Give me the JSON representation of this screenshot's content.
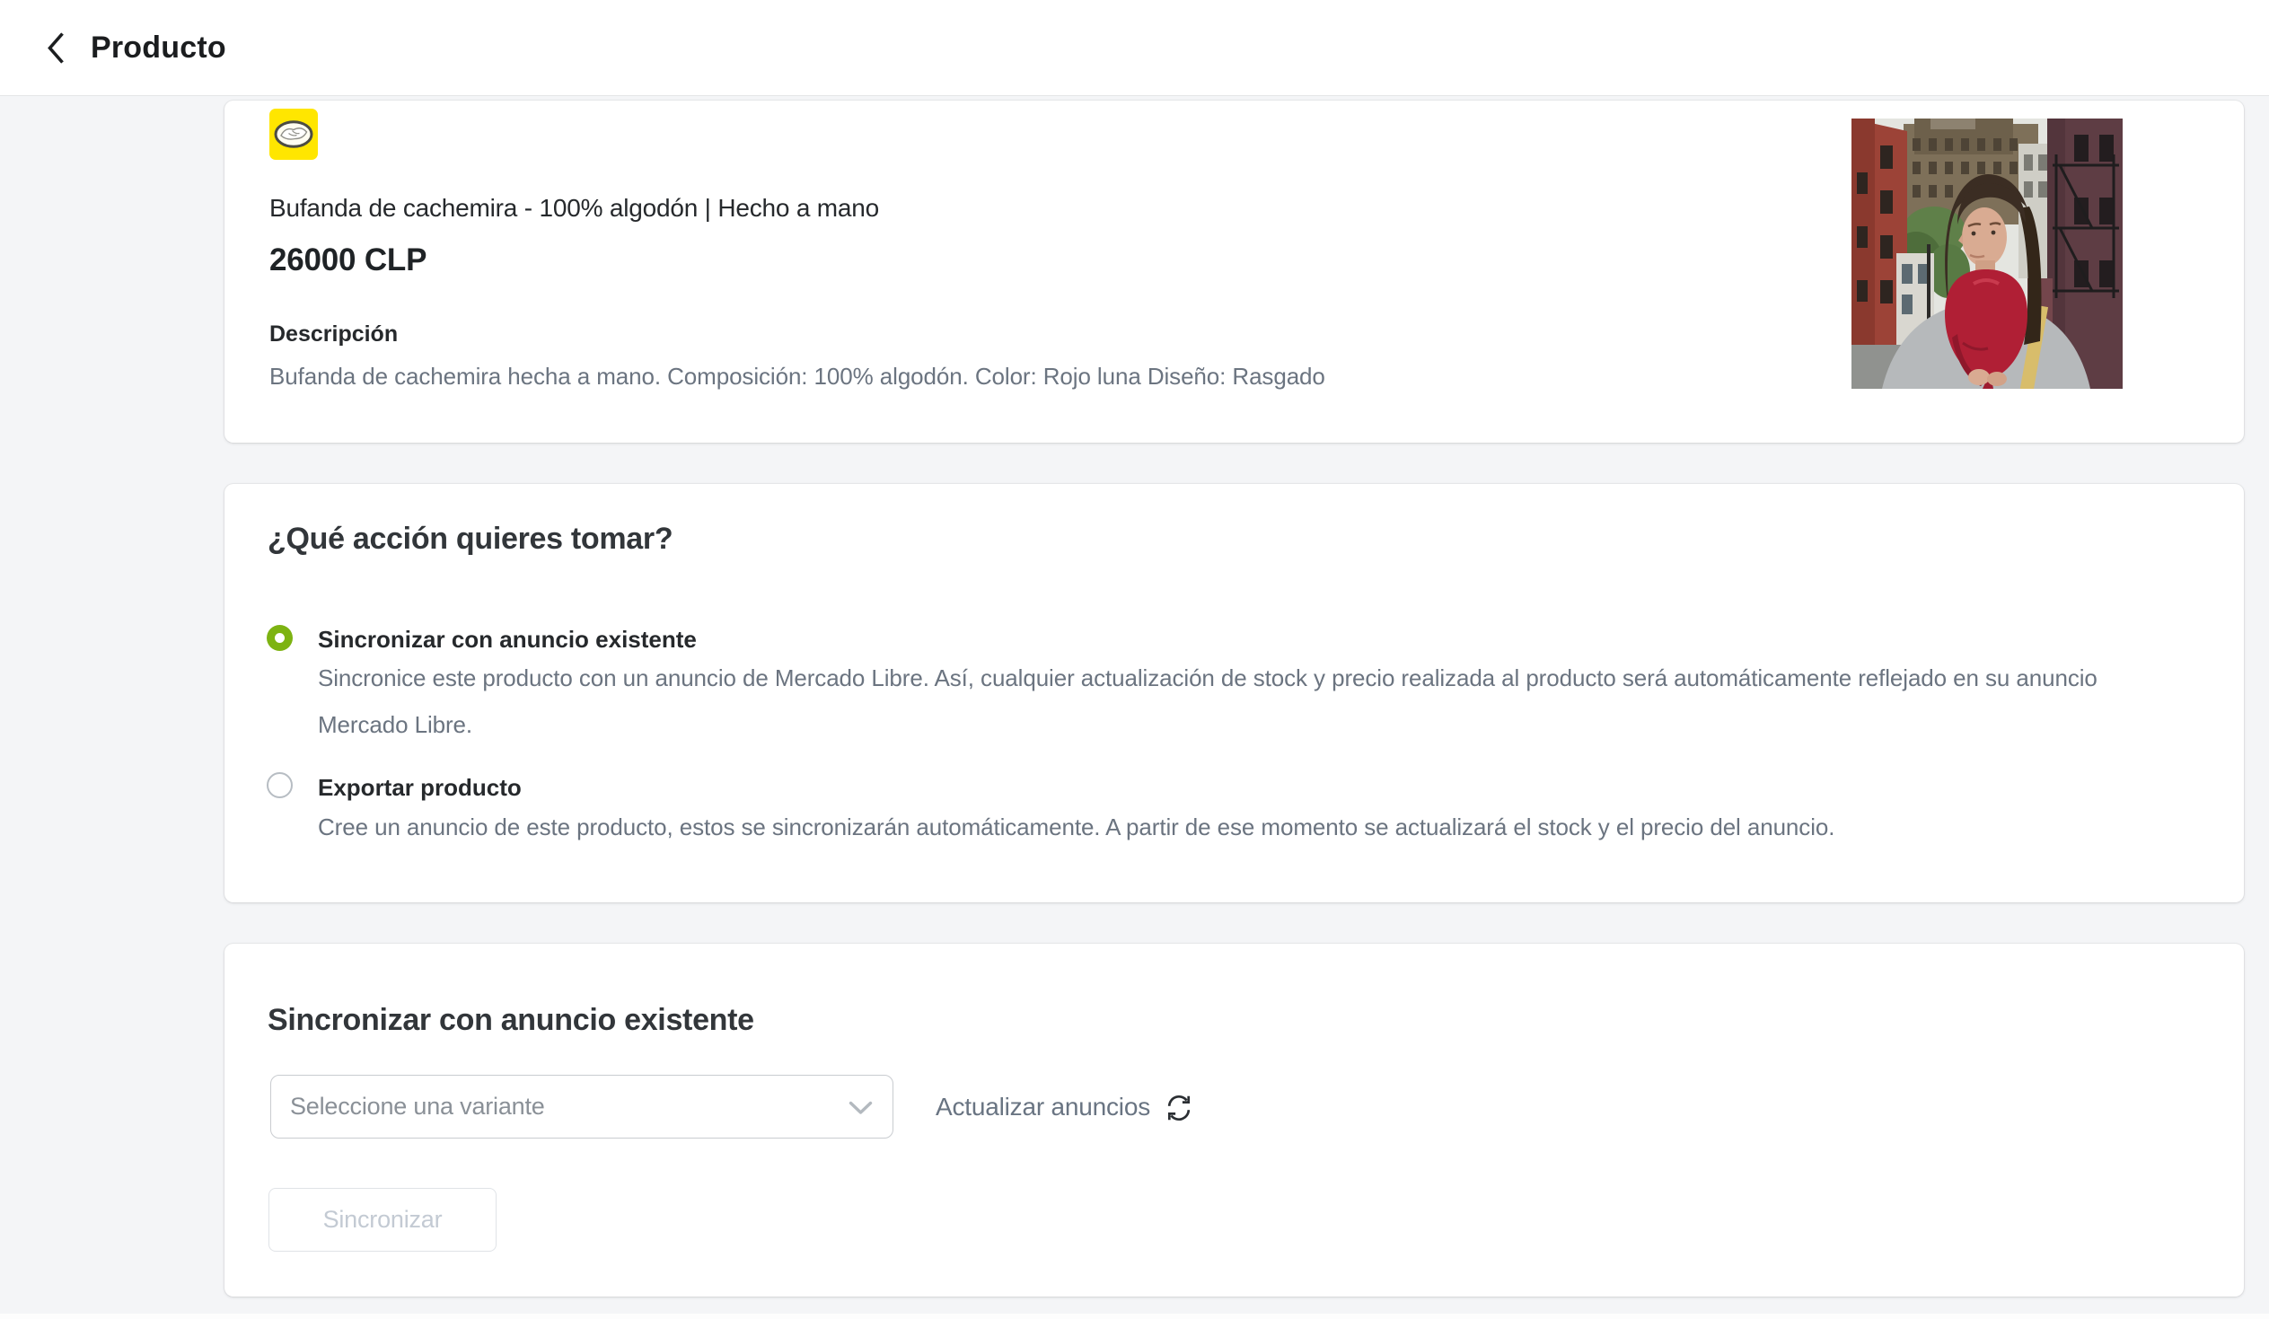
{
  "header": {
    "back_label": "Producto"
  },
  "product_card": {
    "marketplace_icon": "mercado-libre-icon",
    "title": "Bufanda de cachemira - 100% algodón | Hecho a mano",
    "price": "26000 CLP",
    "description_label": "Descripción",
    "description": "Bufanda de cachemira hecha a mano. Composición: 100% algodón. Color: Rojo luna Diseño: Rasgado"
  },
  "action_card": {
    "title": "¿Qué acción quieres tomar?",
    "options": [
      {
        "label": "Sincronizar con anuncio existente",
        "description": "Sincronice este producto con un anuncio de Mercado Libre. Así, cualquier actualización de stock y precio realizada al producto será automáticamente reflejado en su anuncio Mercado Libre.",
        "selected": true
      },
      {
        "label": "Exportar producto",
        "description": "Cree un anuncio de este producto, estos se sincronizarán automáticamente. A partir de ese momento se actualizará el stock y el precio del anuncio.",
        "selected": false
      }
    ]
  },
  "sync_card": {
    "title": "Sincronizar con anuncio existente",
    "variant_select": {
      "placeholder": "Seleccione una variante"
    },
    "refresh_link_label": "Actualizar anuncios",
    "sync_button_label": "Sincronizar",
    "sync_button_disabled": true
  },
  "icons": {
    "back": "chevron-left-icon",
    "select": "chevron-down-icon",
    "refresh": "refresh-icon"
  },
  "colors": {
    "background": "#f4f5f7",
    "accent_green": "#7db312",
    "mercado_libre_yellow": "#ffe600",
    "text_dark": "#26292c",
    "text_gray": "#6b7480"
  }
}
